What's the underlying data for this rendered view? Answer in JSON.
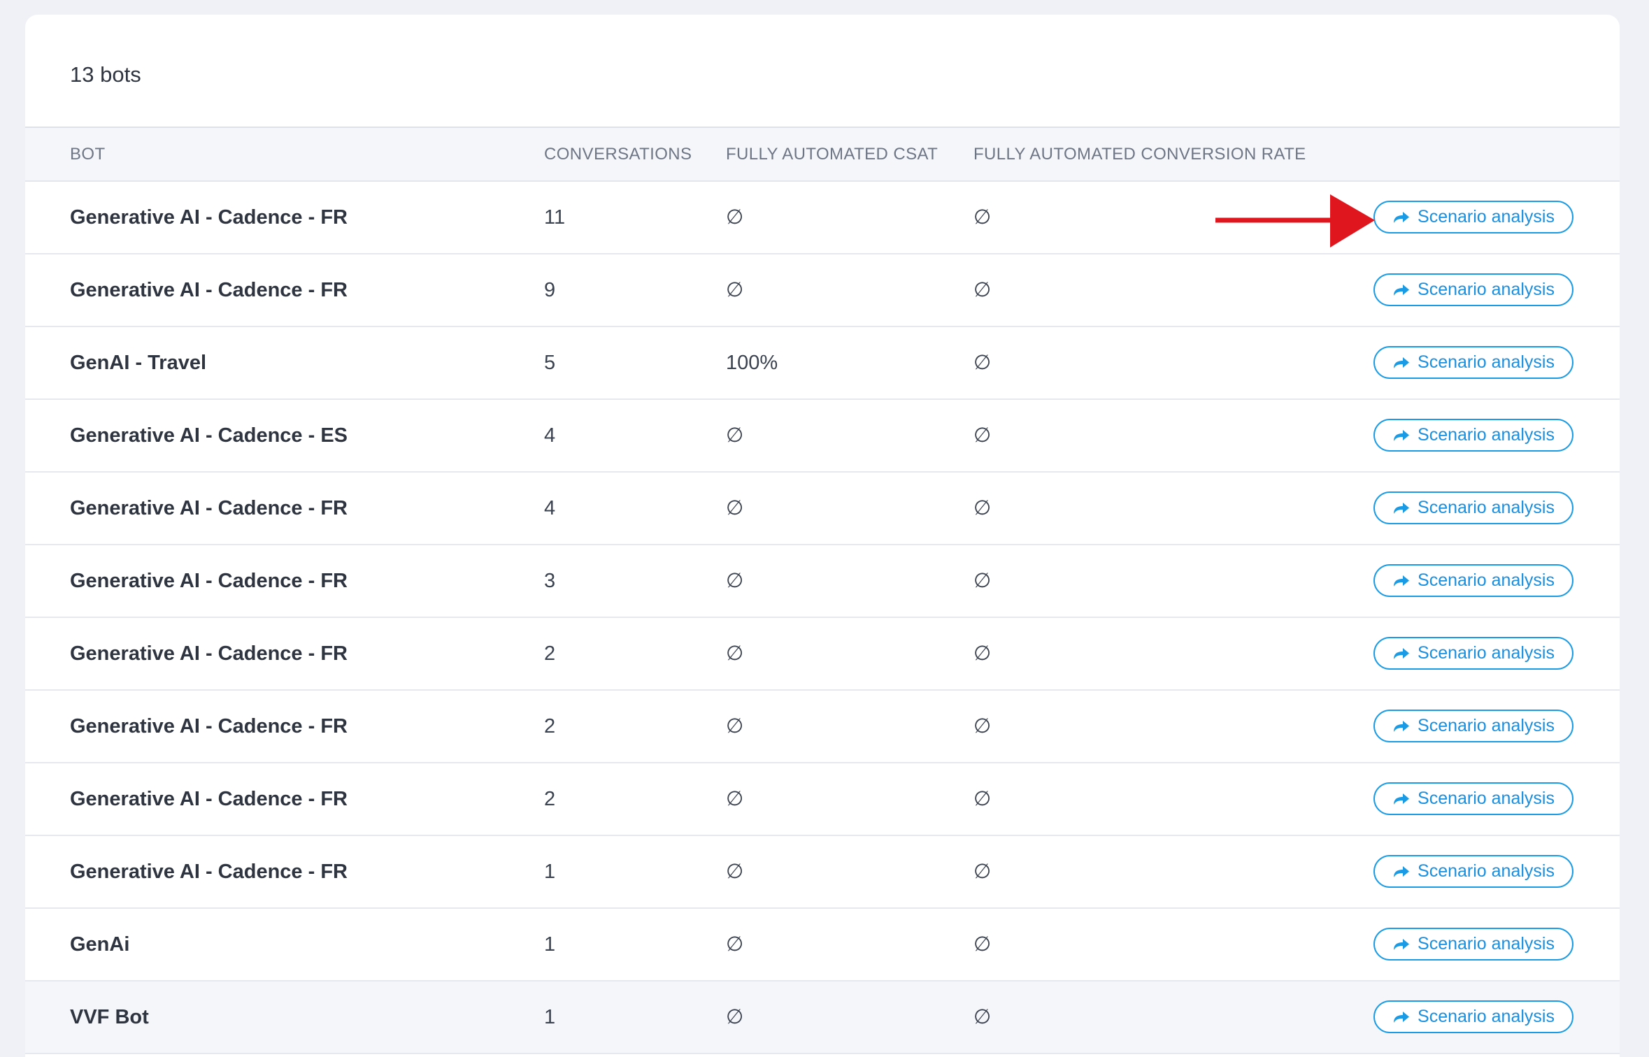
{
  "header": {
    "title": "13 bots"
  },
  "table": {
    "columns": {
      "bot": "BOT",
      "conversations": "CONVERSATIONS",
      "csat": "FULLY AUTOMATED CSAT",
      "conversion_rate": "FULLY AUTOMATED CONVERSION RATE"
    },
    "action_label": "Scenario analysis",
    "action_icon": "share-arrow-icon",
    "rows": [
      {
        "bot": "Generative AI - Cadence - FR",
        "conversations": "11",
        "csat": "∅",
        "conversion_rate": "∅"
      },
      {
        "bot": "Generative AI - Cadence - FR",
        "conversations": "9",
        "csat": "∅",
        "conversion_rate": "∅"
      },
      {
        "bot": "GenAI - Travel",
        "conversations": "5",
        "csat": "100%",
        "conversion_rate": "∅"
      },
      {
        "bot": "Generative AI - Cadence - ES",
        "conversations": "4",
        "csat": "∅",
        "conversion_rate": "∅"
      },
      {
        "bot": "Generative AI - Cadence - FR",
        "conversations": "4",
        "csat": "∅",
        "conversion_rate": "∅"
      },
      {
        "bot": "Generative AI - Cadence - FR",
        "conversations": "3",
        "csat": "∅",
        "conversion_rate": "∅"
      },
      {
        "bot": "Generative AI - Cadence - FR",
        "conversations": "2",
        "csat": "∅",
        "conversion_rate": "∅"
      },
      {
        "bot": "Generative AI - Cadence - FR",
        "conversations": "2",
        "csat": "∅",
        "conversion_rate": "∅"
      },
      {
        "bot": "Generative AI - Cadence - FR",
        "conversations": "2",
        "csat": "∅",
        "conversion_rate": "∅"
      },
      {
        "bot": "Generative AI - Cadence - FR",
        "conversations": "1",
        "csat": "∅",
        "conversion_rate": "∅"
      },
      {
        "bot": "GenAi",
        "conversations": "1",
        "csat": "∅",
        "conversion_rate": "∅"
      },
      {
        "bot": "VVF Bot",
        "conversations": "1",
        "csat": "∅",
        "conversion_rate": "∅"
      }
    ]
  },
  "annotation": {
    "type": "red-arrow-pointer",
    "color": "#e0161e",
    "target_row": 0
  },
  "colors": {
    "accent": "#1a9be6",
    "background": "#eff1f7",
    "annotation": "#e0161e"
  }
}
